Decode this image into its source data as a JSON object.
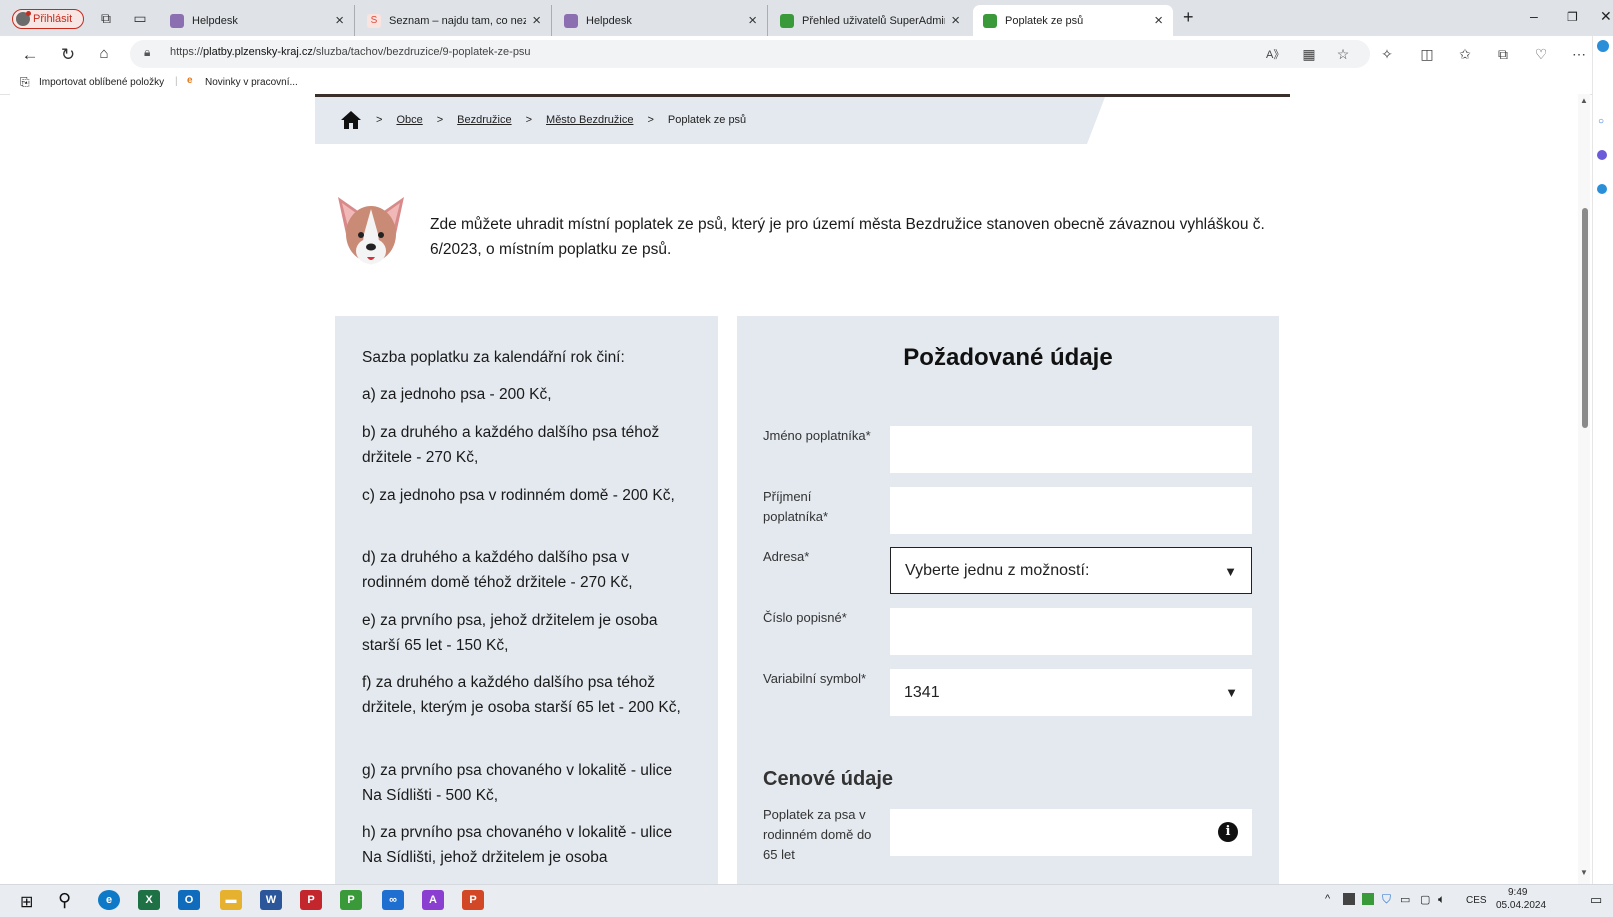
{
  "browser": {
    "signin_label": "Přihlásit",
    "tabs": [
      {
        "title": "Helpdesk",
        "favicon_color": "#8b6fb0"
      },
      {
        "title": "Seznam – najdu tam, co neznám",
        "favicon_color": "#d94a3a"
      },
      {
        "title": "Helpdesk",
        "favicon_color": "#8b6fb0"
      },
      {
        "title": "Přehled uživatelů SuperAdmin",
        "favicon_color": "#3a9a3a"
      },
      {
        "title": "Poplatek ze psů",
        "favicon_color": "#3a9a3a"
      }
    ],
    "url_prefix": "https://",
    "url_domain": "platby.plzensky-kraj.cz",
    "url_path": "/sluzba/tachov/bezdruzice/9-poplatek-ze-psu",
    "favorites": [
      {
        "label": "Importovat oblíbené položky"
      },
      {
        "label": "Novinky v pracovní..."
      }
    ]
  },
  "breadcrumb": {
    "items": [
      "Obce",
      "Bezdružice",
      "Město Bezdružice"
    ],
    "current": "Poplatek ze psů"
  },
  "intro_text": "Zde můžete uhradit místní poplatek ze psů, který je pro území města Bezdružice stanoven obecně závaznou vyhláškou č. 6/2023, o místním poplatku ze psů.",
  "rates": {
    "heading": "Sazba poplatku za kalendářní rok činí:",
    "items": [
      "a) za jednoho psa - 200 Kč,",
      "b) za druhého a každého dalšího psa téhož držitele - 270 Kč,",
      "c) za jednoho psa v rodinném domě - 200 Kč,",
      "d) za druhého a každého dalšího psa v rodinném domě téhož držitele - 270 Kč,",
      "e) za prvního psa, jehož držitelem je osoba starší 65 let - 150 Kč,",
      "f) za druhého a každého dalšího psa téhož držitele, kterým je osoba starší 65 let - 200 Kč,",
      "g) za prvního psa chovaného v lokalitě - ulice Na Sídlišti - 500 Kč,",
      "h) za prvního psa chovaného v lokalitě - ulice Na Sídlišti, jehož držitelem je osoba"
    ]
  },
  "form": {
    "title": "Požadované údaje",
    "first_name_label": "Jméno poplatníka*",
    "last_name_label": "Příjmení poplatníka*",
    "address_label": "Adresa*",
    "address_value": "Vyberte jednu z možností:",
    "house_number_label": "Číslo popisné*",
    "variable_symbol_label": "Variabilní symbol*",
    "variable_symbol_value": "1341",
    "price_section_title": "Cenové údaje",
    "fee_label": "Poplatek za psa v rodinném domě do 65 let"
  },
  "taskbar": {
    "lang": "CES",
    "time": "9:49",
    "date": "05.04.2024"
  }
}
